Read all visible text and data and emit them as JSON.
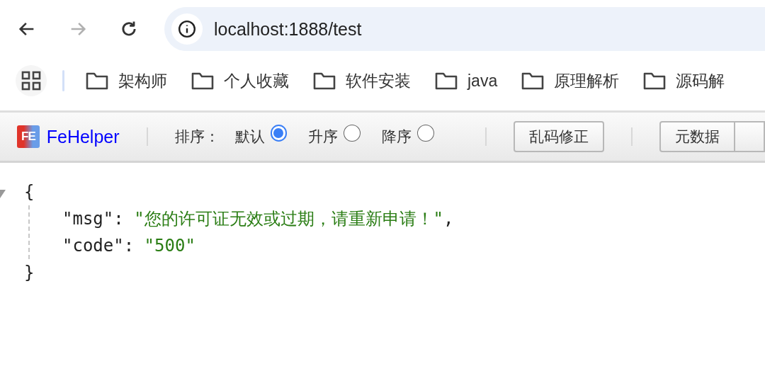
{
  "browser": {
    "url": "localhost:1888/test",
    "back_enabled": true,
    "forward_enabled": false
  },
  "bookmarks": [
    {
      "label": "架构师"
    },
    {
      "label": "个人收藏"
    },
    {
      "label": "软件安装"
    },
    {
      "label": "java"
    },
    {
      "label": "原理解析"
    },
    {
      "label": "源码解"
    }
  ],
  "fehelper": {
    "logo": "FE",
    "title": "FeHelper",
    "sort_label": "排序：",
    "sort_options": [
      {
        "label": "默认",
        "selected": true
      },
      {
        "label": "升序",
        "selected": false
      },
      {
        "label": "降序",
        "selected": false
      }
    ],
    "fix_button": "乱码修正",
    "tabs": [
      {
        "label": "元数据"
      }
    ]
  },
  "json_view": {
    "open": "{",
    "close": "}",
    "entries": [
      {
        "key": "\"msg\"",
        "separator": ":",
        "value": "\"您的许可证无效或过期，请重新申请！\"",
        "comma": ","
      },
      {
        "key": "\"code\"",
        "separator": ":",
        "value": "\"500\""
      }
    ]
  }
}
